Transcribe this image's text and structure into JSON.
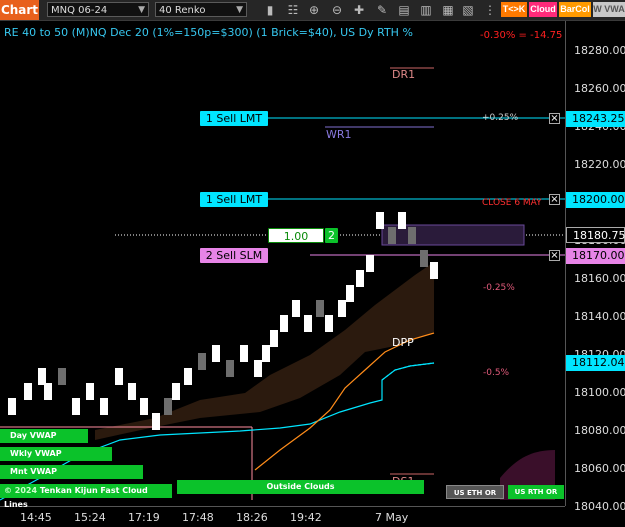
{
  "toolbar": {
    "chart_tab": "Chart",
    "instrument": "MNQ 06-24",
    "bar_type": "40 Renko",
    "badges": [
      "T<>K",
      "Cloud",
      "BarCol",
      "W VWA"
    ]
  },
  "title": "RE 40 to 50 (M)NQ Dec 20 (1%=150p=$300) (1 Brick=$40), US Dy RTH %",
  "pnl": "-0.30% = -14.75",
  "orders": {
    "sell_lmt_1": "1 Sell LMT",
    "sell_lmt_2": "1 Sell LMT",
    "sell_slm": "2 Sell SLM",
    "qty_price": "1.00",
    "qty_count": "2"
  },
  "levels": {
    "dr1": "DR1",
    "wr1": "WR1",
    "dpp": "DPP",
    "ds1": "DS1",
    "close_label": "CLOSE 6 MAY",
    "pct_plus_025": "+0.25%",
    "pct_minus_025": "-0.25%",
    "pct_minus_05": "-0.5%"
  },
  "price_boxes": {
    "p1": "18243.25",
    "p2": "18200.00",
    "p3": "18180.75",
    "p4": "18170.00",
    "p5": "18112.04"
  },
  "y_axis": [
    "18280.00",
    "18260.00",
    "18240.00",
    "18220.00",
    "18200.00",
    "18180.00",
    "18160.00",
    "18140.00",
    "18120.00",
    "18100.00",
    "18080.00",
    "18060.00",
    "18040.00"
  ],
  "x_axis": [
    "14:45",
    "15:24",
    "17:19",
    "17:48",
    "18:26",
    "19:42",
    "7 May"
  ],
  "vwap": {
    "day": "Day VWAP",
    "weekly": "Wkly VWAP",
    "monthly": "Mnt VWAP",
    "kijun": "Tenkan Kijun Fast Cloud Lines",
    "clouds": "Outside Clouds",
    "copyright": "© 2024"
  },
  "session_buttons": {
    "eth": "US ETH OR",
    "rth": "US RTH OR"
  },
  "colors": {
    "cyan": "#00e5ff",
    "magenta": "#e784e7",
    "green": "#0bc22a",
    "orange": "#ff8c1a",
    "toolbar_accent": "#e8601c"
  }
}
